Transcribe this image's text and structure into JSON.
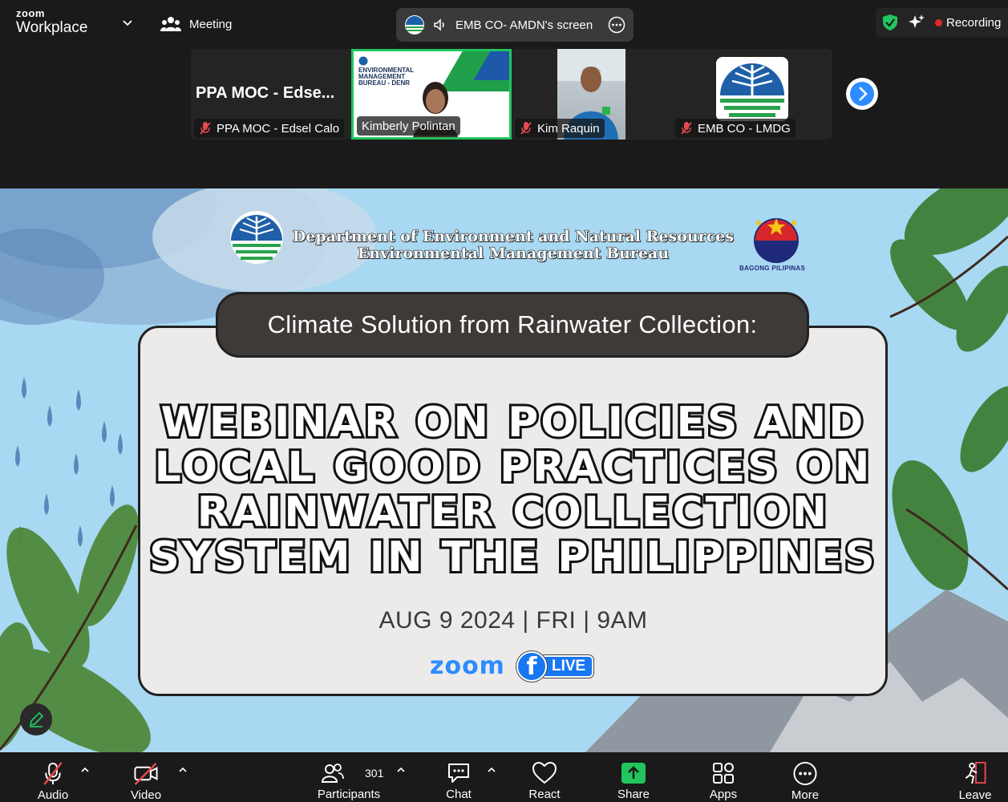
{
  "topbar": {
    "brand_small": "zoom",
    "brand_large": "Workplace",
    "meeting_label": "Meeting",
    "screen_share_label": "EMB CO- AMDN's screen",
    "recording_label": "Recording"
  },
  "participants_strip": [
    {
      "display_name": "PPA MOC - Edse...",
      "label": "PPA MOC - Edsel Calo"
    },
    {
      "label": "Kimberly Polintan",
      "slide_title": "ENVIRONMENTAL\nMANAGEMENT\nBUREAU - DENR"
    },
    {
      "label": "Kim Raquin"
    },
    {
      "label": "EMB CO - LMDG"
    }
  ],
  "slide": {
    "header_line1": "Department of Environment and Natural Resources",
    "header_line2": "Environmental Management Bureau",
    "bagong_label": "BAGONG PILIPINAS",
    "subtitle": "Climate Solution from Rainwater Collection:",
    "title_line1": "Webinar on Policies and",
    "title_line2": "Local Good Practices on",
    "title_line3": "Rainwater Collection",
    "title_line4": "System in the Philippines",
    "date": "AUG 9 2024 | FRI | 9AM",
    "zoom_word": "zoom",
    "fb_letter": "f",
    "live_word": "LIVE"
  },
  "toolbar": {
    "audio": "Audio",
    "video": "Video",
    "participants": "Participants",
    "participants_count": "301",
    "chat": "Chat",
    "react": "React",
    "share": "Share",
    "apps": "Apps",
    "more": "More",
    "leave": "Leave"
  },
  "colors": {
    "accent_blue": "#2d8cff",
    "active_speaker": "#22c55e",
    "share_green": "#22c55e",
    "recording_red": "#e02828",
    "leave_red": "#e5484d"
  },
  "icons": [
    "chevron-down-icon",
    "meeting-icon",
    "speaker-icon",
    "more-icon",
    "shield-icon",
    "sparkle-icon",
    "mic-off-icon",
    "chevron-right-icon",
    "pencil-icon",
    "video-off-icon",
    "participants-icon",
    "chat-icon",
    "heart-icon",
    "share-arrow-icon",
    "apps-icon",
    "leave-icon"
  ]
}
